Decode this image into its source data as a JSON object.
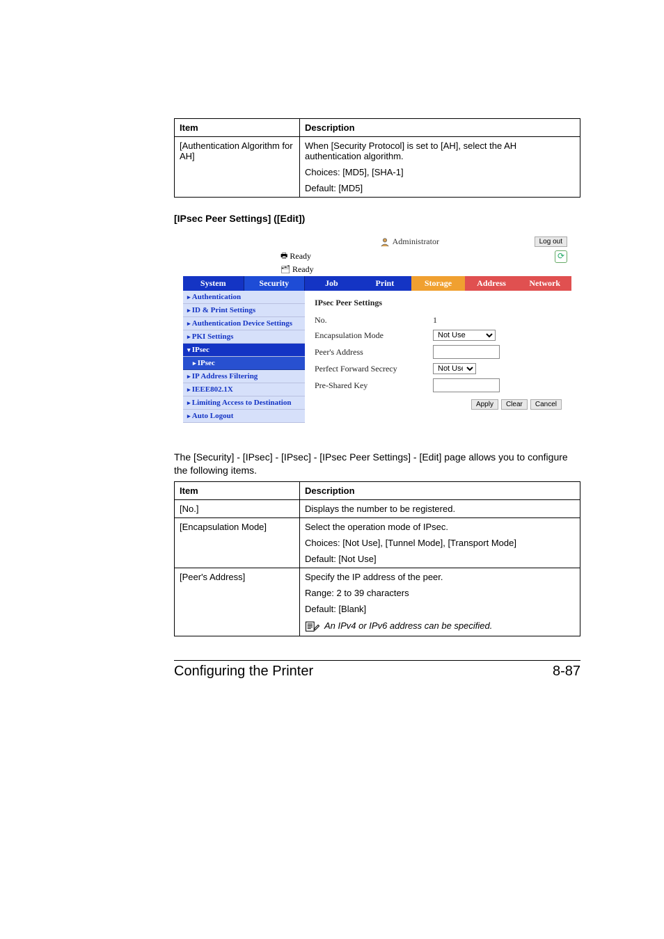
{
  "table1": {
    "headers": {
      "item": "Item",
      "desc": "Description"
    },
    "row": {
      "item": "[Authentication Algorithm for AH]",
      "d1": "When [Security Protocol] is set to [AH], select the AH authentication algorithm.",
      "d2": "Choices: [MD5], [SHA-1]",
      "d3": "Default: [MD5]"
    }
  },
  "subhead": "[IPsec Peer Settings] ([Edit])",
  "admin": {
    "user": "Administrator",
    "logout": "Log out",
    "ready1": "Ready",
    "ready2": "Ready",
    "side_tabs": {
      "system": "System",
      "security": "Security"
    },
    "side_items": {
      "authentication": "Authentication",
      "idprint": "ID & Print Settings",
      "authdev": "Authentication Device Settings",
      "pki": "PKI Settings",
      "ipsec_group": "IPsec",
      "ipsec": "IPsec",
      "ipfilter": "IP Address Filtering",
      "ieee": "IEEE802.1X",
      "limiting": "Limiting Access to Destination",
      "autologout": "Auto Logout"
    },
    "main_tabs": {
      "job": "Job",
      "print": "Print",
      "storage": "Storage",
      "address": "Address",
      "network": "Network"
    },
    "form": {
      "title": "IPsec Peer Settings",
      "no_label": "No.",
      "no_val": "1",
      "encap_label": "Encapsulation Mode",
      "encap_val": "Not Use",
      "peer_label": "Peer's Address",
      "pfs_label": "Perfect Forward Secrecy",
      "pfs_val": "Not Use",
      "psk_label": "Pre-Shared Key"
    },
    "buttons": {
      "apply": "Apply",
      "clear": "Clear",
      "cancel": "Cancel"
    }
  },
  "intro": "The [Security] - [IPsec] - [IPsec] - [IPsec Peer Settings] - [Edit] page allows you to configure the following items.",
  "table2": {
    "headers": {
      "item": "Item",
      "desc": "Description"
    },
    "rows": {
      "no": {
        "item": "[No.]",
        "desc": "Displays the number to be registered."
      },
      "encap": {
        "item": "[Encapsulation Mode]",
        "d1": "Select the operation mode of IPsec.",
        "d2": "Choices: [Not Use], [Tunnel Mode], [Transport Mode]",
        "d3": "Default: [Not Use]"
      },
      "peer": {
        "item": "[Peer's Address]",
        "d1": "Specify the IP address of the peer.",
        "d2": "Range: 2 to 39 characters",
        "d3": "Default: [Blank]",
        "note": "An IPv4 or IPv6 address can be specified."
      }
    }
  },
  "footer": {
    "left": "Configuring the Printer",
    "right": "8-87"
  }
}
